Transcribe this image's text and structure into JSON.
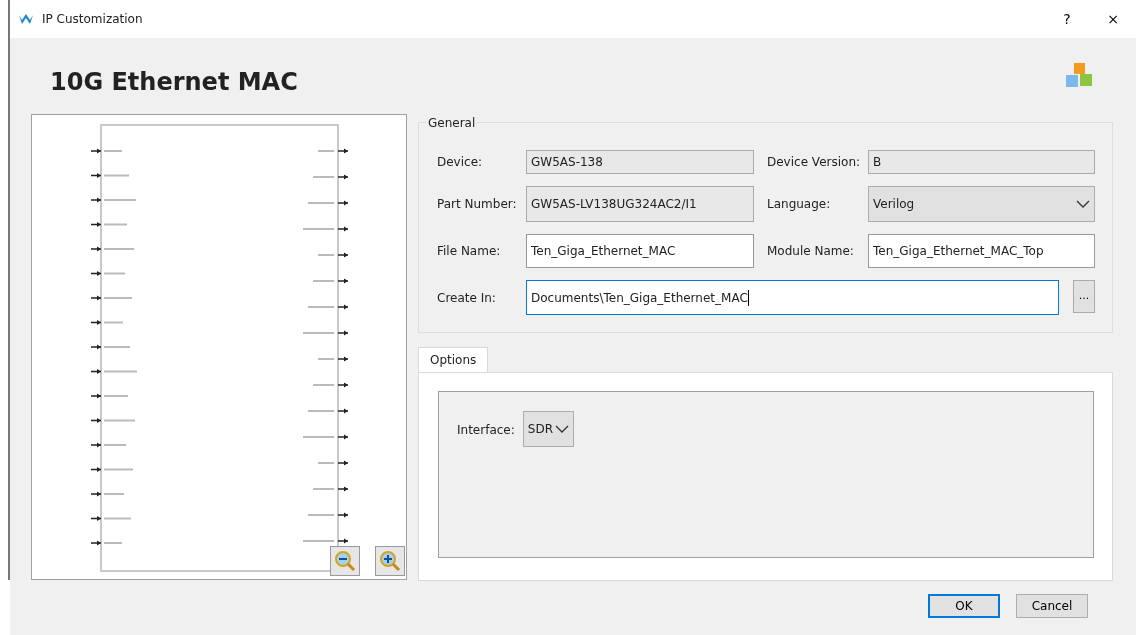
{
  "window": {
    "title": "IP Customization",
    "help": "?",
    "close": "×"
  },
  "heading": "10G Ethernet MAC",
  "general": {
    "title": "General",
    "fields": [
      {
        "label": "Device:",
        "value": "GW5AS-138",
        "kind": "readonly"
      },
      {
        "label": "Device Version:",
        "value": "B",
        "kind": "readonly"
      },
      {
        "label": "Part Number:",
        "value": "GW5AS-LV138UG324AC2/I1",
        "kind": "readonly"
      },
      {
        "label": "Language:",
        "value": "Verilog",
        "kind": "select"
      },
      {
        "label": "File Name:",
        "value": "Ten_Giga_Ethernet_MAC",
        "kind": "text"
      },
      {
        "label": "Module Name:",
        "value": "Ten_Giga_Ethernet_MAC_Top",
        "kind": "text"
      },
      {
        "label": "Create In:",
        "value": "Documents\\Ten_Giga_Ethernet_MAC",
        "kind": "path",
        "browse": "...",
        "focused": true
      }
    ]
  },
  "tabs": [
    {
      "label": "Options",
      "selected": true
    }
  ],
  "options": {
    "label": "Interface:",
    "value": "SDR"
  },
  "buttons": [
    {
      "label": "OK",
      "default": true
    },
    {
      "label": "Cancel",
      "default": false
    }
  ]
}
